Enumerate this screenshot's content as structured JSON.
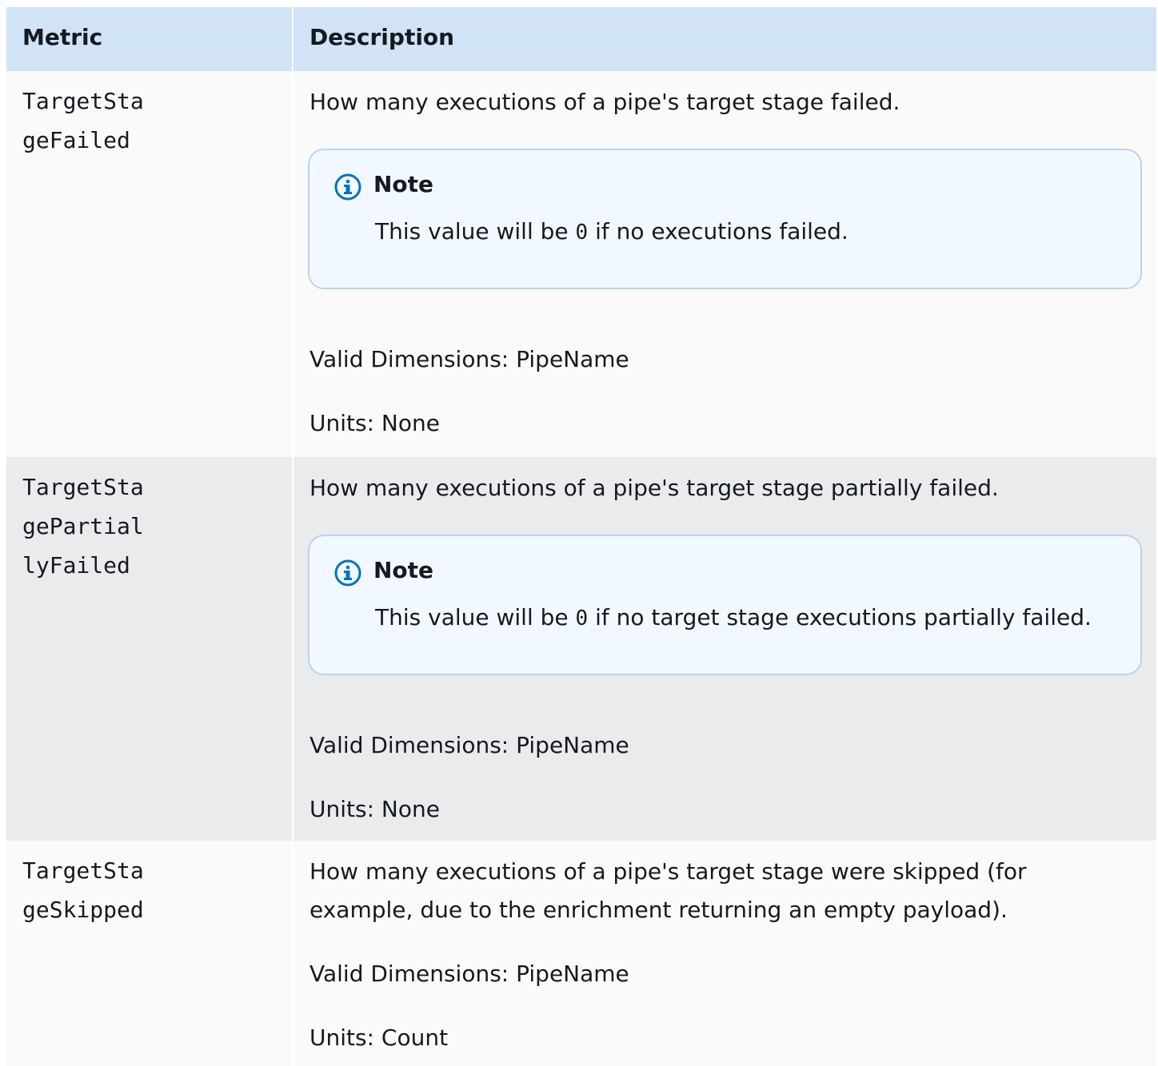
{
  "table": {
    "headers": {
      "metric": "Metric",
      "description": "Description"
    },
    "rows": [
      {
        "metric_line1": "TargetSta",
        "metric_line2": "geFailed",
        "metric_line3": "",
        "description": "How many executions of a pipe's target stage failed.",
        "note_title": "Note",
        "note_before": "This value will be ",
        "note_code": "0",
        "note_after": " if no executions failed.",
        "dimensions": "Valid Dimensions: PipeName",
        "units": "Units: None"
      },
      {
        "metric_line1": "TargetSta",
        "metric_line2": "gePartial",
        "metric_line3": "lyFailed",
        "description": "How many executions of a pipe's target stage partially failed.",
        "note_title": "Note",
        "note_before": "This value will be ",
        "note_code": "0",
        "note_after": " if no target stage executions partially failed.",
        "dimensions": "Valid Dimensions: PipeName",
        "units": "Units: None"
      },
      {
        "metric_line1": "TargetSta",
        "metric_line2": "geSkipped",
        "description_line1": "How many executions of a pipe's target stage were skipped (for",
        "description_line2": "example, due to the enrichment returning an empty payload).",
        "dimensions": "Valid Dimensions: PipeName",
        "units": "Units: Count"
      }
    ]
  },
  "colors": {
    "header_bg": "#d1e4f7",
    "row_light": "#fafafa",
    "row_gray": "#eaebed",
    "note_bg": "#f1f8ff",
    "note_border": "#b8d4ef",
    "info_icon": "#0073bb"
  },
  "icons": {
    "note": "info-circle-icon"
  }
}
